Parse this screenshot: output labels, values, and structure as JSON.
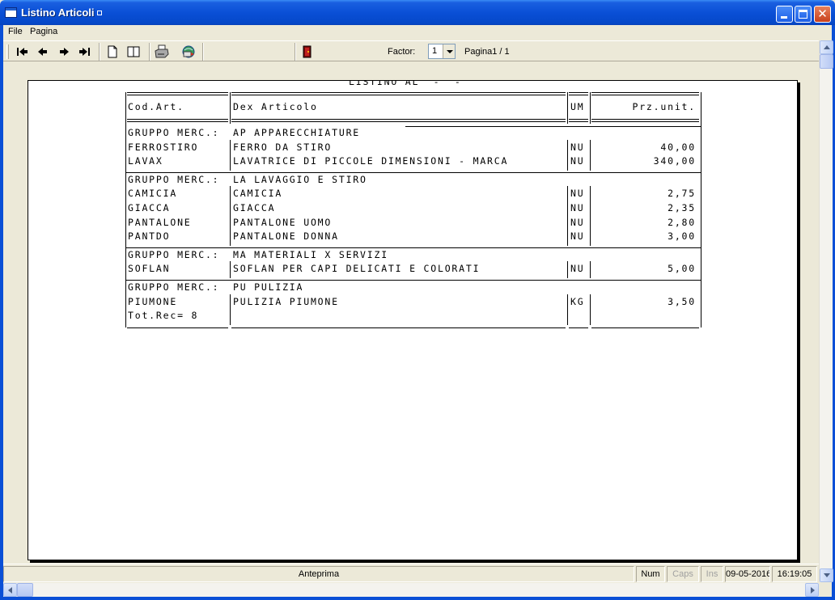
{
  "window": {
    "title": "Listino Articoli"
  },
  "menu": {
    "file": "File",
    "pagina": "Pagina"
  },
  "toolbar": {
    "factor_label": "Factor:",
    "factor_value": "1",
    "page_label": "Pagina1 / 1",
    "icons": [
      "first-page-icon",
      "prev-page-icon",
      "next-page-icon",
      "last-page-icon",
      "single-page-icon",
      "two-pages-icon",
      "print-icon",
      "export-icon",
      "exit-icon"
    ]
  },
  "report": {
    "title": "LISTINO AL  -  -",
    "headers": {
      "code": "Cod.Art.",
      "description": "Dex Articolo",
      "um": "UM",
      "price": "Prz.unit."
    },
    "groups": [
      {
        "label": "GRUPPO MERC.:",
        "name": "AP APPARECCHIATURE",
        "items": [
          {
            "code": "FERROSTIRO",
            "description": "FERRO DA STIRO",
            "um": "NU",
            "price": "40,00"
          },
          {
            "code": "LAVAX",
            "description": "LAVATRICE DI PICCOLE DIMENSIONI - MARCA",
            "um": "NU",
            "price": "340,00"
          }
        ]
      },
      {
        "label": "GRUPPO MERC.:",
        "name": "LA LAVAGGIO E STIRO",
        "items": [
          {
            "code": "CAMICIA",
            "description": "CAMICIA",
            "um": "NU",
            "price": "2,75"
          },
          {
            "code": "GIACCA",
            "description": "GIACCA",
            "um": "NU",
            "price": "2,35"
          },
          {
            "code": "PANTALONE",
            "description": "PANTALONE UOMO",
            "um": "NU",
            "price": "2,80"
          },
          {
            "code": "PANTDO",
            "description": "PANTALONE DONNA",
            "um": "NU",
            "price": "3,00"
          }
        ]
      },
      {
        "label": "GRUPPO MERC.:",
        "name": "MA MATERIALI X SERVIZI",
        "items": [
          {
            "code": "SOFLAN",
            "description": "SOFLAN PER CAPI DELICATI E COLORATI",
            "um": "NU",
            "price": "5,00"
          }
        ]
      },
      {
        "label": "GRUPPO MERC.:",
        "name": "PU PULIZIA",
        "items": [
          {
            "code": "PIUMONE",
            "description": "PULIZIA PIUMONE",
            "um": "KG",
            "price": "3,50"
          }
        ]
      }
    ],
    "total": "Tot.Rec= 8"
  },
  "status": {
    "main": "Anteprima",
    "num": "Num",
    "caps": "Caps",
    "ins": "Ins",
    "date": "09-05-2016",
    "time": "16:19:05"
  },
  "colors": {
    "titlebar": "#0a4fd6",
    "chrome": "#ece9d8",
    "paper": "#ffffff"
  }
}
